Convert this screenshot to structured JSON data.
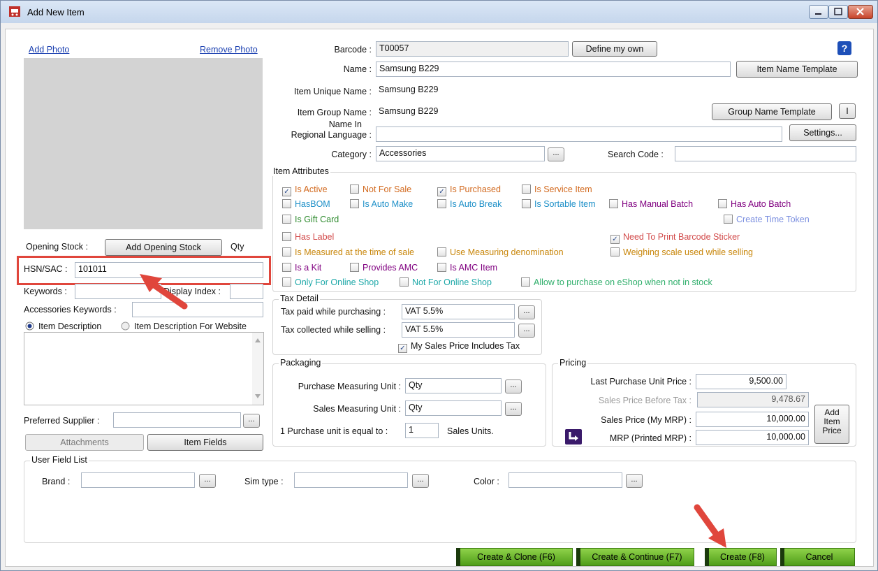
{
  "window": {
    "title": "Add New Item"
  },
  "photo": {
    "add": "Add Photo",
    "remove": "Remove Photo"
  },
  "stock": {
    "label": "Opening Stock :",
    "button": "Add Opening Stock",
    "unit": "Qty"
  },
  "hsn": {
    "label": "HSN/SAC :",
    "value": "101011"
  },
  "keywords": {
    "label": "Keywords :",
    "display_index": "Display Index :",
    "accessories": "Accessories Keywords :"
  },
  "description": {
    "opt1": "Item Description",
    "opt2": "Item Description For Website"
  },
  "supplier": {
    "label": "Preferred Supplier :",
    "dots": "..."
  },
  "buttons": {
    "attachments": "Attachments",
    "item_fields": "Item Fields"
  },
  "fields": {
    "barcode_label": "Barcode :",
    "barcode": "T00057",
    "define_own": "Define my own",
    "help": "?",
    "name_label": "Name :",
    "name": "Samsung B229",
    "name_template": "Item Name Template",
    "unique_label": "Item Unique Name :",
    "unique": "Samsung B229",
    "group_label": "Item Group Name :",
    "group": "Samsung B229",
    "group_template": "Group Name Template",
    "group_extra": "I",
    "regional_label_1": "Name In",
    "regional_label_2": "Regional Language :",
    "settings": "Settings...",
    "category_label": "Category :",
    "category": "Accessories",
    "search_label": "Search Code :"
  },
  "attributes": {
    "title": "Item Attributes",
    "items": [
      {
        "label": "Is Active",
        "checked": true,
        "color": "#d2691e"
      },
      {
        "label": "Not For Sale",
        "checked": false,
        "color": "#d2691e"
      },
      {
        "label": "Is Purchased",
        "checked": true,
        "color": "#d2691e"
      },
      {
        "label": "Is Service Item",
        "checked": false,
        "color": "#d2691e"
      },
      {
        "label": "HasBOM",
        "checked": false,
        "color": "#1e90c8"
      },
      {
        "label": "Is Auto Make",
        "checked": false,
        "color": "#1e90c8"
      },
      {
        "label": "Is Auto Break",
        "checked": false,
        "color": "#1e90c8"
      },
      {
        "label": "Is Sortable Item",
        "checked": false,
        "color": "#1e90c8"
      },
      {
        "label": "Has Manual Batch",
        "checked": false,
        "color": "#800080"
      },
      {
        "label": "Has Auto Batch",
        "checked": false,
        "color": "#800080"
      },
      {
        "label": "Is Gift Card",
        "checked": false,
        "color": "#2e8b2e"
      },
      {
        "label": "Create Time Token",
        "checked": false,
        "color": "#7b8fe0"
      },
      {
        "label": "Has Label",
        "checked": false,
        "color": "#d24a4a"
      },
      {
        "label": "Need To Print Barcode Sticker",
        "checked": true,
        "color": "#d24a4a"
      },
      {
        "label": "Is Measured at the time of sale",
        "checked": false,
        "color": "#c8860a"
      },
      {
        "label": "Use Measuring denomination",
        "checked": false,
        "color": "#c8860a"
      },
      {
        "label": "Weighing scale used while selling",
        "checked": false,
        "color": "#c8860a"
      },
      {
        "label": "Is a Kit",
        "checked": false,
        "color": "#800080"
      },
      {
        "label": "Provides AMC",
        "checked": false,
        "color": "#800080"
      },
      {
        "label": "Is AMC Item",
        "checked": false,
        "color": "#800080"
      },
      {
        "label": "Only For Online Shop",
        "checked": false,
        "color": "#1ea8a8"
      },
      {
        "label": "Not For Online Shop",
        "checked": false,
        "color": "#1ea8a8"
      },
      {
        "label": "Allow to purchase on eShop when not in stock",
        "checked": false,
        "color": "#2eae6a"
      }
    ]
  },
  "tax": {
    "title": "Tax Detail",
    "paid_label": "Tax paid while purchasing :",
    "paid": "VAT 5.5%",
    "collected_label": "Tax collected while selling :",
    "collected": "VAT 5.5%",
    "includes": "My Sales Price Includes Tax"
  },
  "packaging": {
    "title": "Packaging",
    "purchase_label": "Purchase Measuring Unit :",
    "purchase": "Qty",
    "sales_label": "Sales Measuring Unit :",
    "sales": "Qty",
    "equal_label": "1  Purchase unit is equal to :",
    "equal": "1",
    "equal_suffix": "Sales Units."
  },
  "pricing": {
    "title": "Pricing",
    "last_label": "Last Purchase  Unit Price :",
    "last": "9,500.00",
    "before_tax_label": "Sales Price Before Tax :",
    "before_tax": "9,478.67",
    "sales_label": "Sales Price (My MRP) :",
    "sales": "10,000.00",
    "mrp_label": "MRP (Printed MRP) :",
    "mrp": "10,000.00",
    "add_1": "Add",
    "add_2": "Item",
    "add_3": "Price"
  },
  "user_fields": {
    "title": "User Field List",
    "brand": "Brand :",
    "sim": "Sim type :",
    "color": "Color :"
  },
  "actions": {
    "clone": "Create & Clone  (F6)",
    "continue": "Create & Continue (F7)",
    "create": "Create (F8)",
    "cancel": "Cancel"
  },
  "colors": {
    "highlight": "#e0463c",
    "arrow": "#e0463c",
    "green": "#6ab52a"
  }
}
